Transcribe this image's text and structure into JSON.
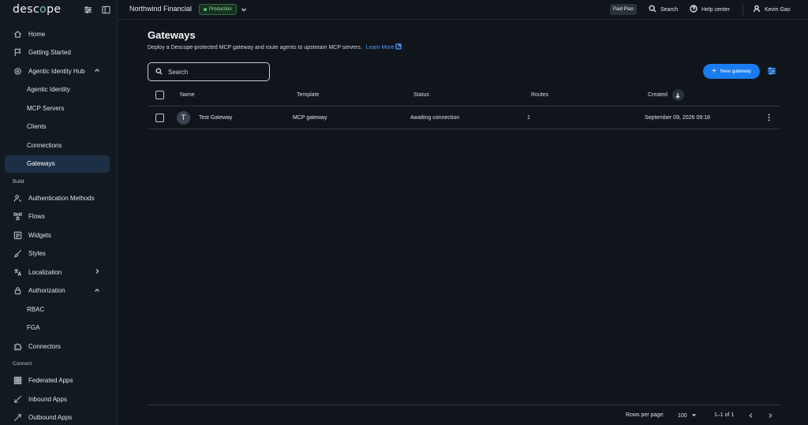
{
  "brand": {
    "name_pre": "desc",
    "name_o": "o",
    "name_post": "pe"
  },
  "sidebar": {
    "items": [
      {
        "label": "Home",
        "icon": "home-icon"
      },
      {
        "label": "Getting Started",
        "icon": "flag-icon"
      },
      {
        "label": "Agentic Identity Hub",
        "icon": "agent-icon"
      },
      {
        "label": "Agentic Identity"
      },
      {
        "label": "MCP Servers"
      },
      {
        "label": "Clients"
      },
      {
        "label": "Connections"
      },
      {
        "label": "Gateways"
      },
      {
        "label": "Authentication Methods",
        "icon": "user-key-icon"
      },
      {
        "label": "Flows",
        "icon": "flows-icon"
      },
      {
        "label": "Widgets",
        "icon": "widgets-icon"
      },
      {
        "label": "Styles",
        "icon": "brush-icon"
      },
      {
        "label": "Localization",
        "icon": "translate-icon"
      },
      {
        "label": "Authorization",
        "icon": "lock-icon"
      },
      {
        "label": "RBAC"
      },
      {
        "label": "FGA"
      },
      {
        "label": "Connectors",
        "icon": "puzzle-icon"
      },
      {
        "label": "Federated Apps",
        "icon": "grid-icon"
      },
      {
        "label": "Inbound Apps",
        "icon": "inbound-icon"
      },
      {
        "label": "Outbound Apps",
        "icon": "outbound-icon"
      }
    ],
    "sections": {
      "build": "Build",
      "connect": "Connect"
    }
  },
  "topbar": {
    "project": "Northwind Financial",
    "environment": "Production",
    "plan": "Paid Plan",
    "search": "Search",
    "help": "Help center",
    "user": "Kevin Gao"
  },
  "page": {
    "title": "Gateways",
    "subtitle": "Deploy a Descope-protected MCP gateway and route agents to upstream MCP servers.",
    "learn_more": "Learn More",
    "search_placeholder": "Search",
    "new_button": "New gateway"
  },
  "table": {
    "headers": {
      "name": "Name",
      "template": "Template",
      "status": "Status",
      "routes": "Routes",
      "created": "Created"
    },
    "rows": [
      {
        "avatar": "T",
        "name": "Test Gateway",
        "template": "MCP gateway",
        "status": "Awaiting connection",
        "routes": "1",
        "created": "September 09, 2026 09:18"
      }
    ]
  },
  "pagination": {
    "rows_label": "Rows per page:",
    "rows_value": "100",
    "range": "1–1 of 1"
  },
  "colors": {
    "accent": "#1a7cf0",
    "active_nav": "#1c2f45",
    "background": "#10151c",
    "env_badge": "#53c07a"
  }
}
